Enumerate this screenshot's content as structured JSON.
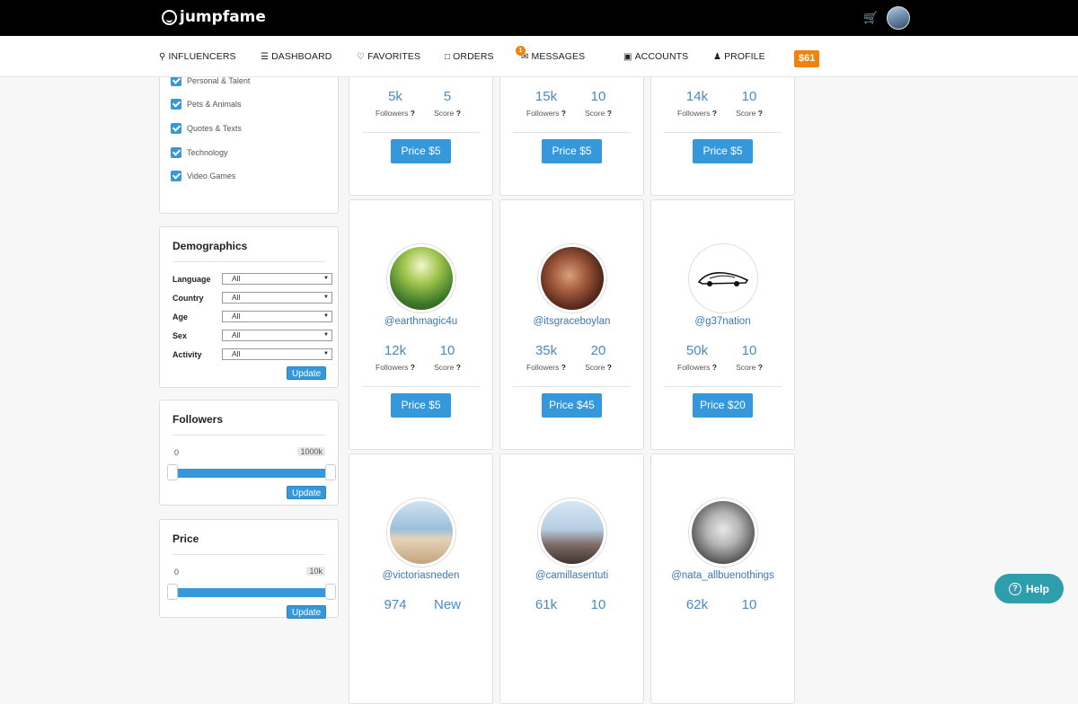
{
  "header": {
    "logo_text": "jumpfame",
    "cart_icon": "cart-icon",
    "avatar": "user-avatar"
  },
  "nav": {
    "items": [
      {
        "label": "INFLUENCERS",
        "icon": "search-icon"
      },
      {
        "label": "DASHBOARD",
        "icon": "list-icon"
      },
      {
        "label": "FAVORITES",
        "icon": "heart-icon"
      },
      {
        "label": "ORDERS",
        "icon": "square-icon"
      },
      {
        "label": "MESSAGES",
        "icon": "envelope-icon",
        "badge": "1"
      },
      {
        "label": "ACCOUNTS",
        "icon": "instagram-icon"
      },
      {
        "label": "PROFILE",
        "icon": "user-icon"
      }
    ],
    "credit": "$61"
  },
  "sidebar": {
    "categories": [
      {
        "label": "Personal & Talent",
        "checked": true
      },
      {
        "label": "Pets & Animals",
        "checked": true
      },
      {
        "label": "Quotes & Texts",
        "checked": true
      },
      {
        "label": "Technology",
        "checked": true
      },
      {
        "label": "Video Games",
        "checked": true
      }
    ],
    "demographics": {
      "title": "Demographics",
      "fields": [
        {
          "label": "Language",
          "value": "All"
        },
        {
          "label": "Country",
          "value": "All"
        },
        {
          "label": "Age",
          "value": "All"
        },
        {
          "label": "Sex",
          "value": "All"
        },
        {
          "label": "Activity",
          "value": "All"
        }
      ],
      "update_label": "Update"
    },
    "followers": {
      "title": "Followers",
      "min": "0",
      "max": "1000k",
      "update_label": "Update"
    },
    "price": {
      "title": "Price",
      "min": "0",
      "max": "10k",
      "update_label": "Update"
    }
  },
  "labels": {
    "followers": "Followers",
    "score": "Score",
    "q": "?"
  },
  "cards": [
    {
      "handle": "",
      "followers": "5k",
      "score": "5",
      "price": "Price $5"
    },
    {
      "handle": "",
      "followers": "15k",
      "score": "10",
      "price": "Price $5"
    },
    {
      "handle": "",
      "followers": "14k",
      "score": "10",
      "price": "Price $5"
    },
    {
      "handle": "@earthmagic4u",
      "followers": "12k",
      "score": "10",
      "price": "Price $5"
    },
    {
      "handle": "@itsgraceboylan",
      "followers": "35k",
      "score": "20",
      "price": "Price $45"
    },
    {
      "handle": "@g37nation",
      "followers": "50k",
      "score": "10",
      "price": "Price $20"
    },
    {
      "handle": "@victoriasneden",
      "followers": "974",
      "score": "New",
      "price": ""
    },
    {
      "handle": "@camillasentuti",
      "followers": "61k",
      "score": "10",
      "price": ""
    },
    {
      "handle": "@nata_allbuenothings",
      "followers": "62k",
      "score": "10",
      "price": ""
    }
  ],
  "help": {
    "label": "Help"
  }
}
